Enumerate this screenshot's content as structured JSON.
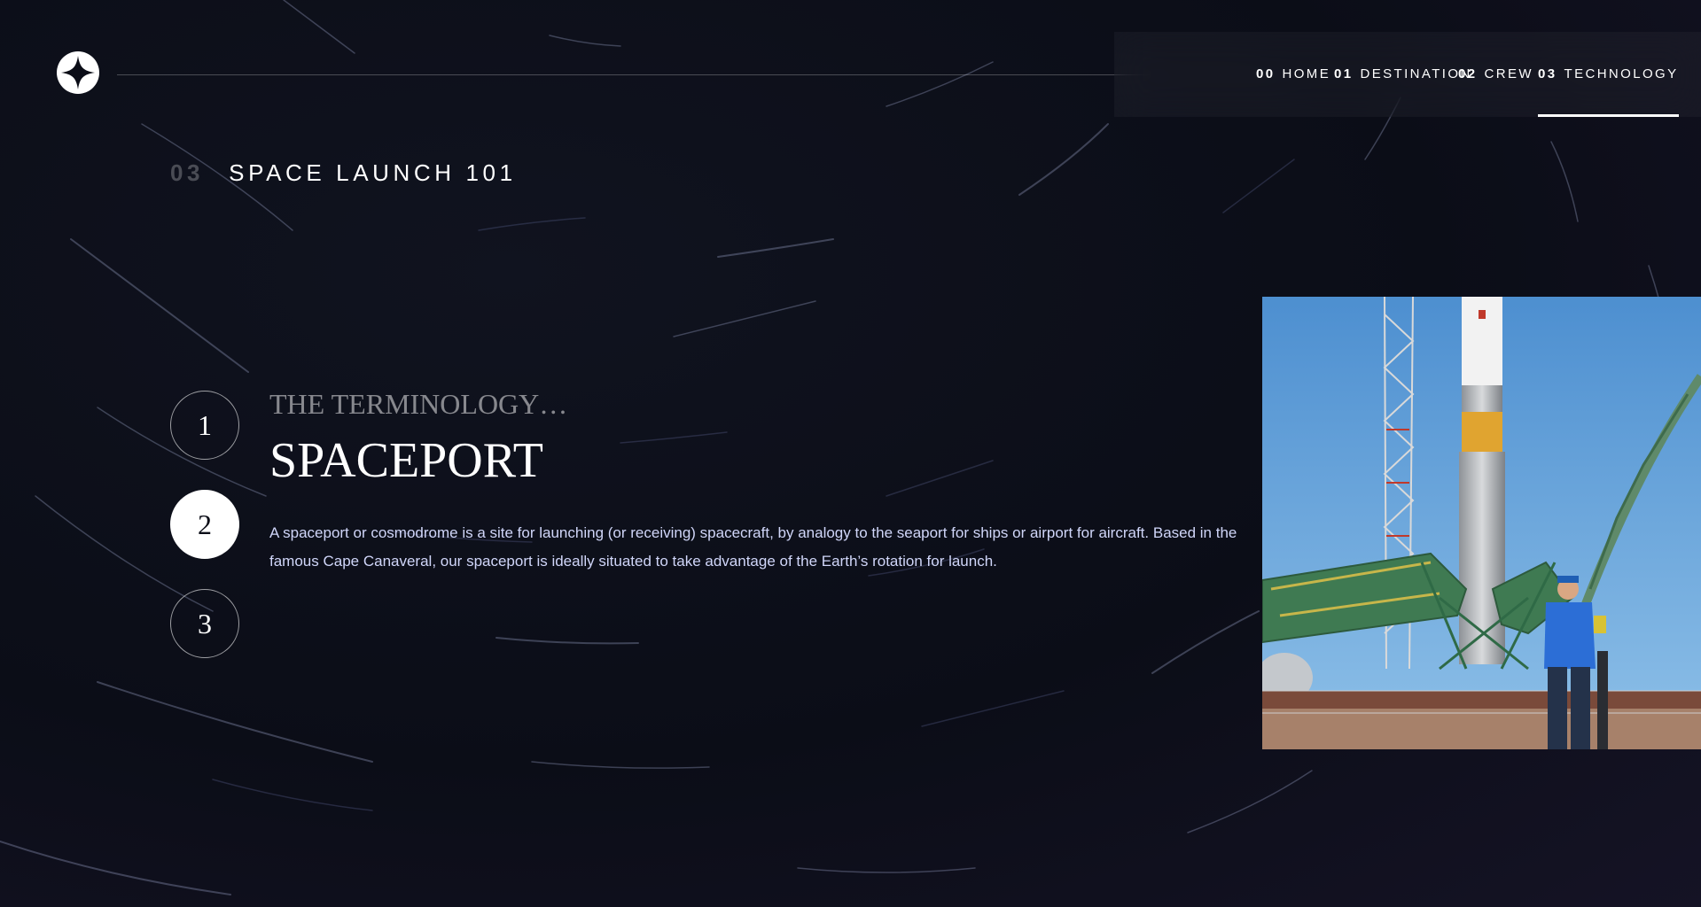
{
  "nav": {
    "items": [
      {
        "num": "00",
        "label": "HOME"
      },
      {
        "num": "01",
        "label": "DESTINATION"
      },
      {
        "num": "02",
        "label": "CREW"
      },
      {
        "num": "03",
        "label": "TECHNOLOGY"
      }
    ],
    "active_index": 3
  },
  "page": {
    "num": "03",
    "heading": "SPACE LAUNCH 101"
  },
  "steps": [
    "1",
    "2",
    "3"
  ],
  "active_step": 2,
  "content": {
    "subtitle": "THE TERMINOLOGY…",
    "title": "SPACEPORT",
    "description": "A spaceport or cosmodrome is a site for launching (or receiving) spacecraft, by analogy to the seaport for ships or airport for aircraft. Based in the famous Cape Canaveral, our spaceport is ideally situated to take advantage of the Earth’s rotation for launch."
  },
  "icons": {
    "logo": "four-point-star-icon"
  },
  "colors": {
    "background": "#0b0d17",
    "accent_text": "#d0d6f9",
    "white": "#ffffff"
  }
}
